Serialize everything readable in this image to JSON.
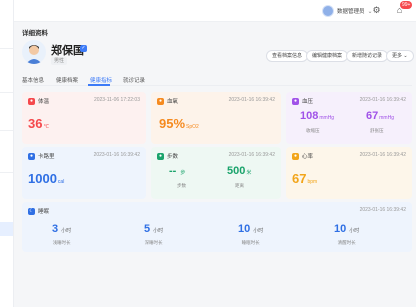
{
  "topbar": {
    "user_name": "数据管理员",
    "notification_count": "99+",
    "icons": [
      "avatar-icon",
      "chevron-down-icon",
      "gear-icon",
      "bell-icon"
    ]
  },
  "page": {
    "title": "详细资料"
  },
  "patient": {
    "name": "郑保国",
    "tag": "男性",
    "buttons": [
      "查看档案信息",
      "编辑健康档案",
      "新增随访记录",
      "更多"
    ]
  },
  "tabs": {
    "items": [
      "基本信息",
      "健康档案",
      "健康指标",
      "就诊记录"
    ],
    "active_index": 2
  },
  "cards": {
    "temperature": {
      "title": "体温",
      "time": "2023-11-06 17:22:03",
      "value": "36",
      "unit": "℃",
      "color": "#f5484c"
    },
    "spo2": {
      "title": "血氧",
      "time": "2023-01-16 16:39:42",
      "value": "95%",
      "unit": "SpO2",
      "color": "#f58a1f"
    },
    "bp": {
      "title": "血压",
      "time": "2023-01-16 16:39:42",
      "sys": "108",
      "sys_unit": "mmHg",
      "dia": "67",
      "dia_unit": "mmHg",
      "sys_label": "收缩压",
      "dia_label": "舒张压",
      "color": "#a052e8"
    },
    "calories": {
      "title": "卡路里",
      "time": "2023-01-16 16:39:42",
      "value": "1000",
      "unit": "cal",
      "color": "#2f6fe4"
    },
    "steps": {
      "title": "步数",
      "time": "2023-01-16 16:39:42",
      "left": "-- ",
      "left_unit": "步",
      "right": "500",
      "right_unit": "米",
      "left_label": "步数",
      "right_label": "距离",
      "color": "#1aa36b"
    },
    "heart": {
      "title": "心率",
      "time": "2023-01-16 16:39:42",
      "value": "67",
      "unit": "bpm",
      "color": "#f2a51a"
    }
  },
  "sleep": {
    "title": "睡眠",
    "time": "2023-01-16 16:39:42",
    "stats": [
      {
        "value": "3",
        "unit": "小时",
        "label": "浅睡时长"
      },
      {
        "value": "5",
        "unit": "小时",
        "label": "深睡时长"
      },
      {
        "value": "10",
        "unit": "小时",
        "label": "睡眠时长"
      },
      {
        "value": "10",
        "unit": "小时",
        "label": "清醒时长"
      }
    ]
  }
}
